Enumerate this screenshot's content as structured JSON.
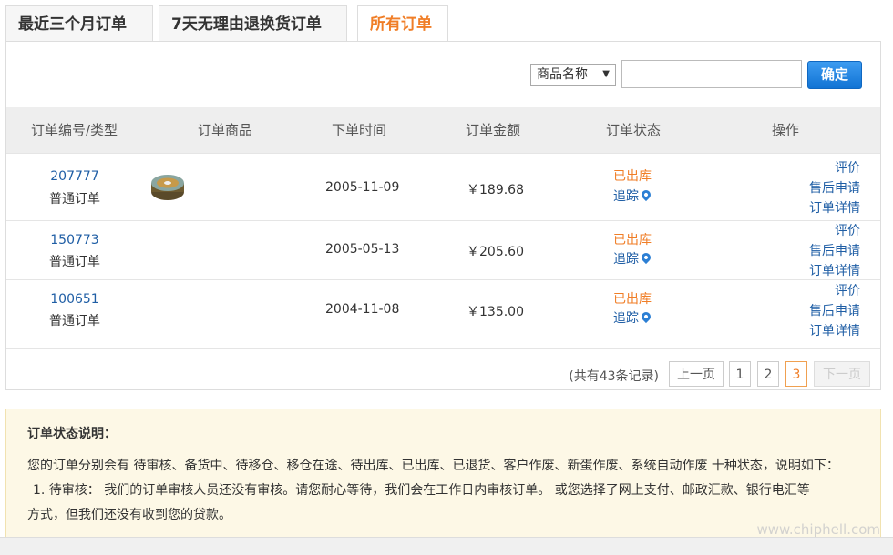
{
  "tabs": [
    {
      "label": "最近三个月订单",
      "active": false
    },
    {
      "label": "7天无理由退换货订单",
      "active": false
    },
    {
      "label": "所有订单",
      "active": true
    }
  ],
  "search": {
    "select_value": "商品名称",
    "input_value": "",
    "button_label": "确定"
  },
  "table": {
    "headers": [
      "订单编号/类型",
      "订单商品",
      "下单时间",
      "订单金额",
      "订单状态",
      "操作"
    ],
    "rows": [
      {
        "id": "207777",
        "type": "普通订单",
        "date": "2005-11-09",
        "amount": "￥189.68",
        "status": "已出库",
        "track": "追踪",
        "ops": [
          "评价",
          "售后申请",
          "订单详情"
        ]
      },
      {
        "id": "150773",
        "type": "普通订单",
        "date": "2005-05-13",
        "amount": "￥205.60",
        "status": "已出库",
        "track": "追踪",
        "ops": [
          "评价",
          "售后申请",
          "订单详情"
        ]
      },
      {
        "id": "100651",
        "type": "普通订单",
        "date": "2004-11-08",
        "amount": "￥135.00",
        "status": "已出库",
        "track": "追踪",
        "ops": [
          "评价",
          "售后申请",
          "订单详情"
        ]
      }
    ]
  },
  "pager": {
    "total_text": "(共有43条记录)",
    "prev": "上一页",
    "pages": [
      "1",
      "2",
      "3"
    ],
    "current": "3",
    "next": "下一页"
  },
  "notice": {
    "title": "订单状态说明：",
    "line1": "您的订单分别会有 待审核、备货中、待移仓、移仓在途、待出库、已出库、已退货、客户作废、新蛋作废、系统自动作废 十种状态，说明如下：",
    "line2": "1. 待审核：  我们的订单审核人员还没有审核。请您耐心等待，我们会在工作日内审核订单。 或您选择了网上支付、邮政汇款、银行电汇等",
    "line3": "方式，但我们还没有收到您的贷款。"
  },
  "watermark": "www.chiphell.com",
  "colors": {
    "accent": "#f07e27",
    "link": "#1f5ea5",
    "button": "#1b7fe0"
  }
}
